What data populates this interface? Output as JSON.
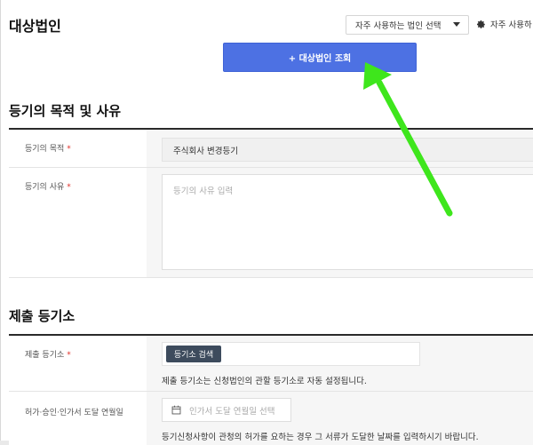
{
  "header": {
    "title": "대상법인",
    "favorites_select": "자주 사용하는 법인 선택",
    "favorites_settings": "자주 사용하"
  },
  "query_button": {
    "label": "+ 대상법인 조회"
  },
  "purpose_section": {
    "title": "등기의 목적 및 사유",
    "purpose_label": "등기의 목적",
    "purpose_value": "주식회사 변경등기",
    "reason_label": "등기의 사유",
    "reason_placeholder": "등기의 사유 입력"
  },
  "registry_section": {
    "title": "제출 등기소",
    "registry_label": "제출 등기소",
    "search_button": "등기소 검색",
    "registry_help": "제출 등기소는 신청법인의 관할 등기소로 자동 설정됩니다.",
    "permit_label": "허가·승인·인가서 도달 연월일",
    "permit_placeholder": "인가서 도달 연월일 선택",
    "permit_help": "등기신청사항이 관청의 허가를 요하는 경우 그 서류가 도달한 날짜를 입력하시기 바랍니다."
  },
  "required_mark": "*",
  "colors": {
    "accent": "#4d71e3",
    "annotation_arrow": "#3ee61c",
    "required": "#e0322b"
  }
}
